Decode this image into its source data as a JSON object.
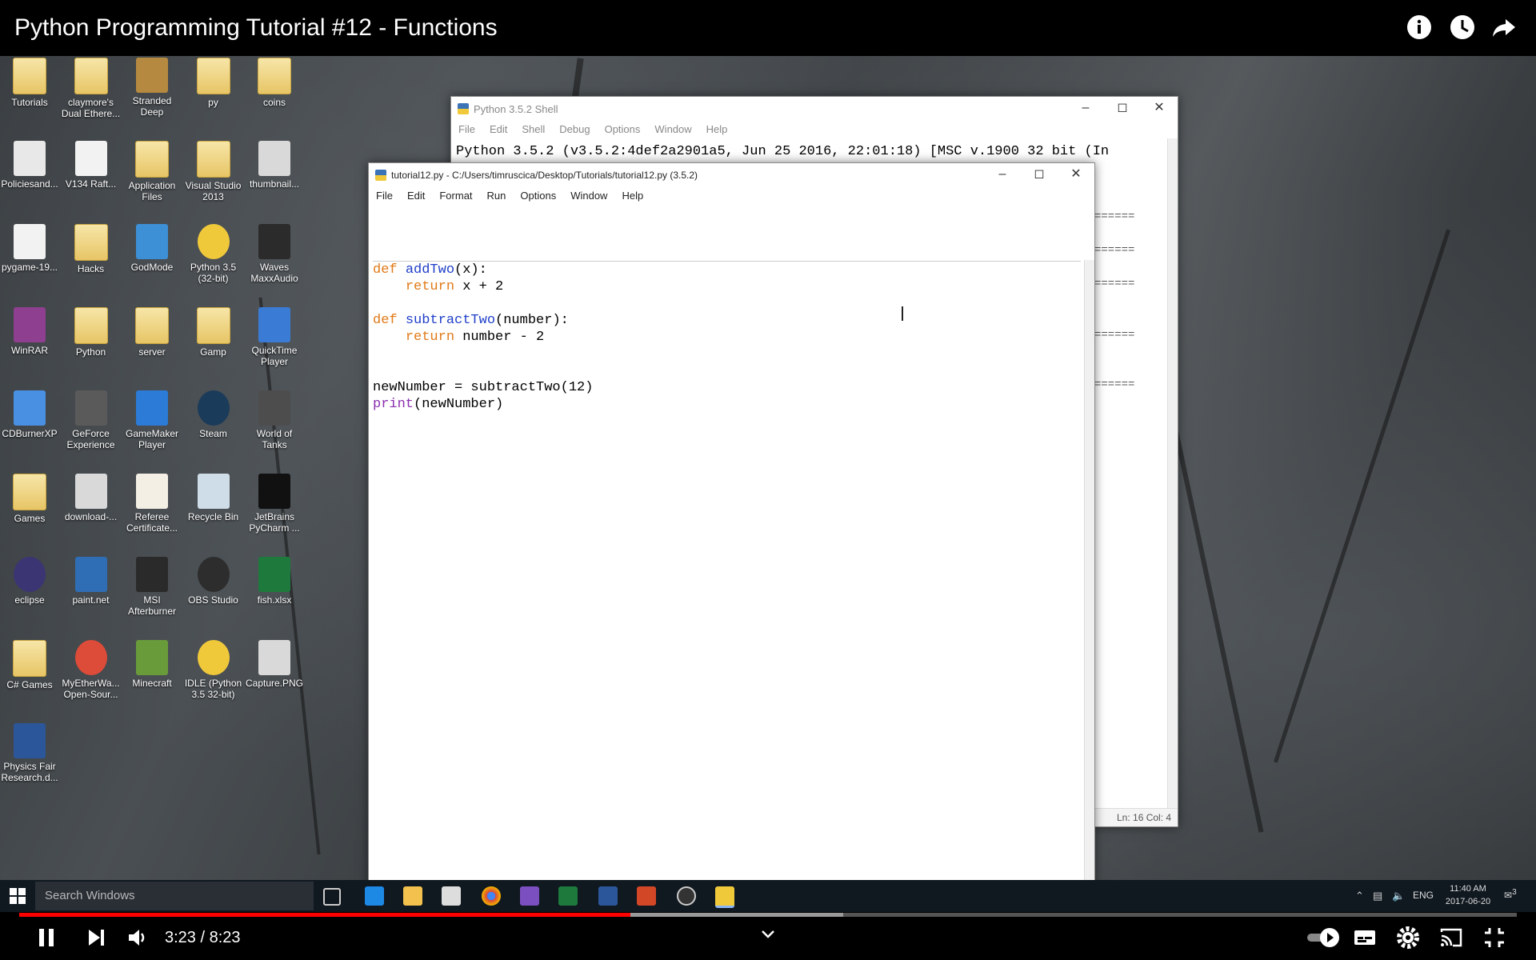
{
  "video": {
    "title": "Python Programming Tutorial #12 - Functions",
    "current_time": "3:23",
    "duration": "8:23",
    "time_separator": " / ",
    "played_fraction": 0.408,
    "buffered_fraction": 0.55
  },
  "desktop_icons": [
    {
      "label": "Tutorials",
      "icon": "folder-icon"
    },
    {
      "label": "claymore's Dual Ethere...",
      "icon": "folder-icon"
    },
    {
      "label": "Stranded Deep",
      "icon": "game-icon"
    },
    {
      "label": "py",
      "icon": "folder-icon"
    },
    {
      "label": "coins",
      "icon": "folder-icon"
    },
    {
      "label": "Policiesand...",
      "icon": "pdf-icon"
    },
    {
      "label": "V134 Raft...",
      "icon": "file-icon"
    },
    {
      "label": "Application Files",
      "icon": "folder-icon"
    },
    {
      "label": "Visual Studio 2013",
      "icon": "folder-icon"
    },
    {
      "label": "thumbnail...",
      "icon": "image-icon"
    },
    {
      "label": "pygame-19...",
      "icon": "file-icon"
    },
    {
      "label": "Hacks",
      "icon": "folder-icon"
    },
    {
      "label": "GodMode",
      "icon": "control-panel-icon"
    },
    {
      "label": "Python 3.5 (32-bit)",
      "icon": "python-icon"
    },
    {
      "label": "Waves MaxxAudio",
      "icon": "audio-icon"
    },
    {
      "label": "WinRAR",
      "icon": "winrar-icon"
    },
    {
      "label": "Python",
      "icon": "folder-icon"
    },
    {
      "label": "server",
      "icon": "folder-icon"
    },
    {
      "label": "Gamp",
      "icon": "folder-icon"
    },
    {
      "label": "QuickTime Player",
      "icon": "quicktime-icon"
    },
    {
      "label": "CDBurnerXP",
      "icon": "cd-icon"
    },
    {
      "label": "GeForce Experience",
      "icon": "nvidia-icon"
    },
    {
      "label": "GameMaker Player",
      "icon": "gamemaker-icon"
    },
    {
      "label": "Steam",
      "icon": "steam-icon"
    },
    {
      "label": "World of Tanks",
      "icon": "tanks-icon"
    },
    {
      "label": "Games",
      "icon": "folder-icon"
    },
    {
      "label": "download-...",
      "icon": "image-icon"
    },
    {
      "label": "Referee Certificate...",
      "icon": "certificate-icon"
    },
    {
      "label": "Recycle Bin",
      "icon": "recycle-bin-icon"
    },
    {
      "label": "JetBrains PyCharm ...",
      "icon": "pycharm-icon"
    },
    {
      "label": "eclipse",
      "icon": "eclipse-icon"
    },
    {
      "label": "paint.net",
      "icon": "paint-icon"
    },
    {
      "label": "MSI Afterburner",
      "icon": "msi-icon"
    },
    {
      "label": "OBS Studio",
      "icon": "obs-icon"
    },
    {
      "label": "fish.xlsx",
      "icon": "excel-icon"
    },
    {
      "label": "C# Games",
      "icon": "folder-icon"
    },
    {
      "label": "MyEtherWa... Open-Sour...",
      "icon": "chrome-icon"
    },
    {
      "label": "Minecraft",
      "icon": "minecraft-icon"
    },
    {
      "label": "IDLE (Python 3.5 32-bit)",
      "icon": "python-icon"
    },
    {
      "label": "Capture.PNG",
      "icon": "image-icon"
    },
    {
      "label": "Physics Fair Research.d...",
      "icon": "word-icon"
    }
  ],
  "shell_window": {
    "title": "Python 3.5.2 Shell",
    "menu": [
      "File",
      "Edit",
      "Shell",
      "Debug",
      "Options",
      "Window",
      "Help"
    ],
    "banner": "Python 3.5.2 (v3.5.2:4def2a2901a5, Jun 25 2016, 22:01:18) [MSC v.1900 32 bit (In",
    "restart_marks": [
      "======",
      "======",
      "======",
      "======",
      "======"
    ],
    "status": "Ln: 16   Col: 4"
  },
  "editor_window": {
    "title": "tutorial12.py - C:/Users/timruscica/Desktop/Tutorials/tutorial12.py (3.5.2)",
    "menu": [
      "File",
      "Edit",
      "Format",
      "Run",
      "Options",
      "Window",
      "Help"
    ],
    "code": {
      "l1_kw": "def",
      "l1_fn": "addTwo",
      "l1_rest": "(x):",
      "l2_kw": "return",
      "l2_rest": " x + 2",
      "l4_kw": "def",
      "l4_fn": "subtractTwo",
      "l4_rest": "(number):",
      "l5_kw": "return",
      "l5_rest": " number - 2",
      "l8": "newNumber = subtractTwo(12)",
      "l9_bi": "print",
      "l9_rest": "(newNumber)"
    }
  },
  "taskbar": {
    "search_placeholder": "Search Windows",
    "language": "ENG",
    "clock_time": "11:40 AM",
    "clock_date": "2017-06-20",
    "notification_count": "3"
  },
  "colors": {
    "keyword": "#e07a18",
    "function_name": "#1f3fc9",
    "builtin": "#8a2fae",
    "progress_played": "#ff0000"
  }
}
